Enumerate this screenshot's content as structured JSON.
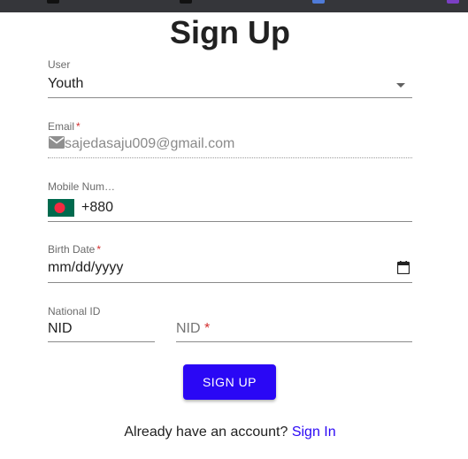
{
  "page": {
    "title": "Sign Up"
  },
  "form": {
    "user": {
      "label": "User",
      "value": "Youth"
    },
    "email": {
      "label": "Email",
      "required_mark": "*",
      "value": "sajedasaju009@gmail.com"
    },
    "mobile": {
      "label": "Mobile Num…",
      "country_code": "+880",
      "flag": "bangladesh-flag"
    },
    "birth_date": {
      "label": "Birth Date",
      "required_mark": "*",
      "value": "mm/dd/yyyy"
    },
    "national_id": {
      "label": "National ID",
      "value": "NID"
    },
    "nid": {
      "placeholder": "NID",
      "required_mark": "*"
    }
  },
  "actions": {
    "signup_label": "SIGN UP"
  },
  "footer": {
    "prompt": "Already have an account? ",
    "link_label": "Sign In"
  },
  "colors": {
    "accent": "#2a07f5",
    "required": "#d32f2f",
    "flag_green": "#006a4e",
    "flag_red": "#f42a41"
  },
  "icons": [
    "mail-icon",
    "calendar-icon",
    "dropdown-arrow-icon"
  ]
}
